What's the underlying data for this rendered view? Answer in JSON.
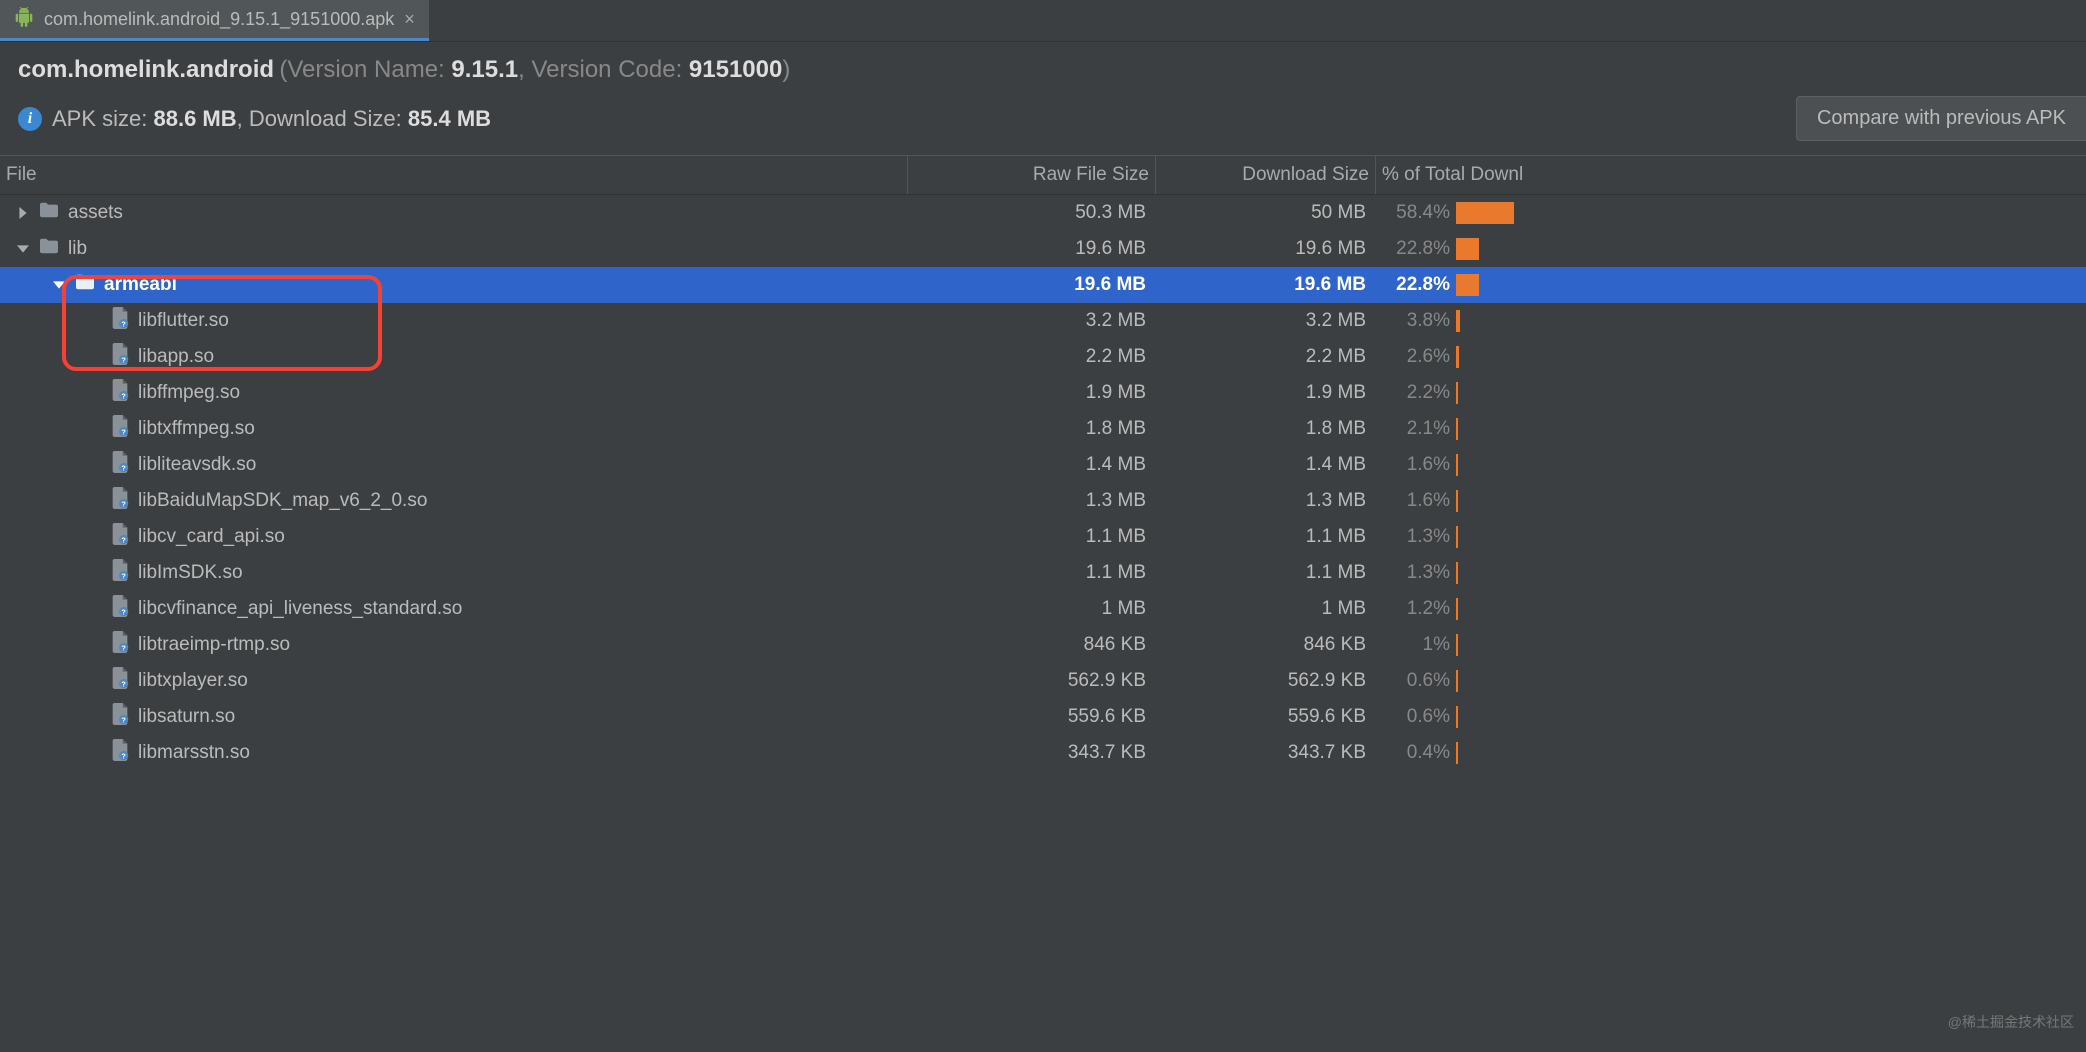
{
  "tab": {
    "label": "com.homelink.android_9.15.1_9151000.apk"
  },
  "header": {
    "package": "com.homelink.android",
    "version_name_label": "Version Name:",
    "version_name": "9.15.1",
    "version_code_label": "Version Code:",
    "version_code": "9151000"
  },
  "info": {
    "apk_size_label": "APK size:",
    "apk_size": "88.6 MB",
    "download_size_label": "Download Size:",
    "download_size": "85.4 MB",
    "compare_button": "Compare with previous APK"
  },
  "columns": {
    "file": "File",
    "raw": "Raw File Size",
    "download": "Download Size",
    "pct": "% of Total Downl"
  },
  "rows": [
    {
      "type": "folder",
      "depth": 0,
      "expand": "right",
      "name": "assets",
      "raw": "50.3 MB",
      "dl": "50 MB",
      "pct": "58.4%",
      "bar": 58.4,
      "selected": false
    },
    {
      "type": "folder",
      "depth": 0,
      "expand": "down",
      "name": "lib",
      "raw": "19.6 MB",
      "dl": "19.6 MB",
      "pct": "22.8%",
      "bar": 22.8,
      "selected": false
    },
    {
      "type": "folder",
      "depth": 1,
      "expand": "down",
      "name": "armeabi",
      "raw": "19.6 MB",
      "dl": "19.6 MB",
      "pct": "22.8%",
      "bar": 22.8,
      "selected": true
    },
    {
      "type": "file",
      "depth": 2,
      "expand": "none",
      "name": "libflutter.so",
      "raw": "3.2 MB",
      "dl": "3.2 MB",
      "pct": "3.8%",
      "bar": 3.8,
      "selected": false
    },
    {
      "type": "file",
      "depth": 2,
      "expand": "none",
      "name": "libapp.so",
      "raw": "2.2 MB",
      "dl": "2.2 MB",
      "pct": "2.6%",
      "bar": 2.6,
      "selected": false
    },
    {
      "type": "file",
      "depth": 2,
      "expand": "none",
      "name": "libffmpeg.so",
      "raw": "1.9 MB",
      "dl": "1.9 MB",
      "pct": "2.2%",
      "bar": 2.2,
      "selected": false
    },
    {
      "type": "file",
      "depth": 2,
      "expand": "none",
      "name": "libtxffmpeg.so",
      "raw": "1.8 MB",
      "dl": "1.8 MB",
      "pct": "2.1%",
      "bar": 2.1,
      "selected": false
    },
    {
      "type": "file",
      "depth": 2,
      "expand": "none",
      "name": "libliteavsdk.so",
      "raw": "1.4 MB",
      "dl": "1.4 MB",
      "pct": "1.6%",
      "bar": 1.6,
      "selected": false
    },
    {
      "type": "file",
      "depth": 2,
      "expand": "none",
      "name": "libBaiduMapSDK_map_v6_2_0.so",
      "raw": "1.3 MB",
      "dl": "1.3 MB",
      "pct": "1.6%",
      "bar": 1.6,
      "selected": false
    },
    {
      "type": "file",
      "depth": 2,
      "expand": "none",
      "name": "libcv_card_api.so",
      "raw": "1.1 MB",
      "dl": "1.1 MB",
      "pct": "1.3%",
      "bar": 1.3,
      "selected": false
    },
    {
      "type": "file",
      "depth": 2,
      "expand": "none",
      "name": "libImSDK.so",
      "raw": "1.1 MB",
      "dl": "1.1 MB",
      "pct": "1.3%",
      "bar": 1.3,
      "selected": false
    },
    {
      "type": "file",
      "depth": 2,
      "expand": "none",
      "name": "libcvfinance_api_liveness_standard.so",
      "raw": "1 MB",
      "dl": "1 MB",
      "pct": "1.2%",
      "bar": 1.2,
      "selected": false
    },
    {
      "type": "file",
      "depth": 2,
      "expand": "none",
      "name": "libtraeimp-rtmp.so",
      "raw": "846 KB",
      "dl": "846 KB",
      "pct": "1%",
      "bar": 1.0,
      "selected": false
    },
    {
      "type": "file",
      "depth": 2,
      "expand": "none",
      "name": "libtxplayer.so",
      "raw": "562.9 KB",
      "dl": "562.9 KB",
      "pct": "0.6%",
      "bar": 0.6,
      "selected": false
    },
    {
      "type": "file",
      "depth": 2,
      "expand": "none",
      "name": "libsaturn.so",
      "raw": "559.6 KB",
      "dl": "559.6 KB",
      "pct": "0.6%",
      "bar": 0.6,
      "selected": false
    },
    {
      "type": "file",
      "depth": 2,
      "expand": "none",
      "name": "libmarsstn.so",
      "raw": "343.7 KB",
      "dl": "343.7 KB",
      "pct": "0.4%",
      "bar": 0.4,
      "selected": false
    }
  ],
  "watermark": "@稀土掘金技术社区"
}
